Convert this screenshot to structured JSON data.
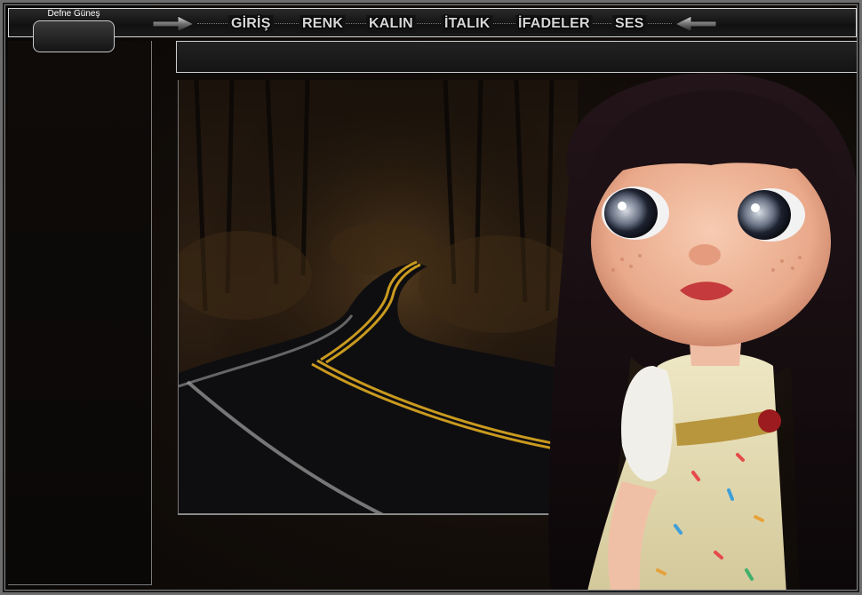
{
  "user": {
    "name": "Defne Güneş"
  },
  "nav": {
    "items": [
      {
        "label": "GİRİŞ"
      },
      {
        "label": "RENK"
      },
      {
        "label": "KALIN"
      },
      {
        "label": "İTALIK"
      },
      {
        "label": "İFADELER"
      },
      {
        "label": "SES"
      }
    ],
    "left_arrow_icon": "arrow-right-icon",
    "right_arrow_icon": "arrow-left-icon"
  },
  "colors": {
    "frame": "#6d6d6d",
    "nav_text": "#d6d6d6",
    "background": "#0a0908"
  }
}
